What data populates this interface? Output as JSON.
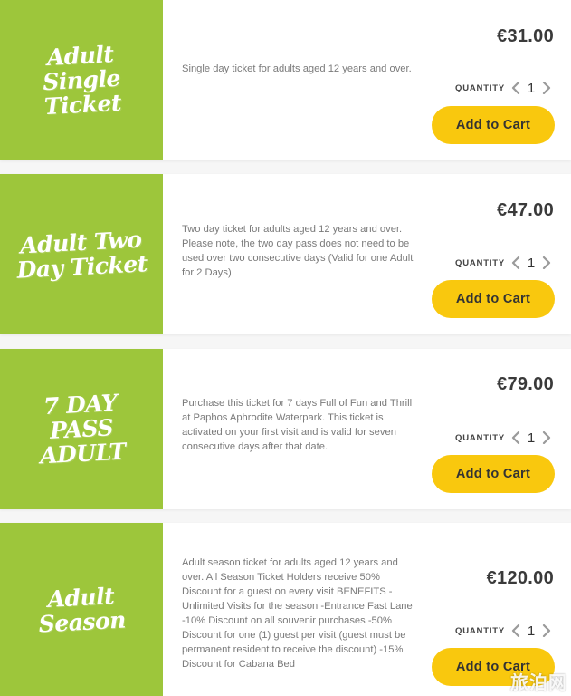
{
  "colors": {
    "accent_green": "#9dc63b",
    "button_yellow": "#f9c80e",
    "price_text": "#3a3a3a",
    "desc_text": "#7a7a7a"
  },
  "quantity_label": "QUANTITY",
  "add_to_cart_label": "Add to Cart",
  "tickets": [
    {
      "title_line1": "Adult Single",
      "title_line2": "Ticket",
      "description": "Single day ticket for adults aged 12 years and over.",
      "price": "€31.00",
      "quantity": "1"
    },
    {
      "title_line1": "Adult Two",
      "title_line2": "Day Ticket",
      "description": "Two day ticket for adults aged 12 years and over. Please note, the two day pass does not need to be used over two consecutive days (Valid for one Adult for 2 Days)",
      "price": "€47.00",
      "quantity": "1"
    },
    {
      "title_line1": "7 DAY PASS",
      "title_line2": "ADULT",
      "description": "Purchase this ticket for 7 days Full of Fun and Thrill at Paphos Aphrodite Waterpark. This ticket is activated on your first visit and is valid for seven consecutive days after that date.",
      "price": "€79.00",
      "quantity": "1"
    },
    {
      "title_line1": "Adult",
      "title_line2": "Season",
      "description": "Adult season ticket for adults aged 12 years and over. All Season Ticket Holders receive 50% Discount for a guest on every visit BENEFITS -Unlimited Visits for the season -Entrance Fast Lane -10% Discount on all souvenir purchases -50% Discount for one (1) guest per visit (guest must be permanent resident to receive the discount) -15% Discount for Cabana Bed",
      "price": "€120.00",
      "quantity": "1"
    }
  ],
  "watermark_text": "旅泊网"
}
